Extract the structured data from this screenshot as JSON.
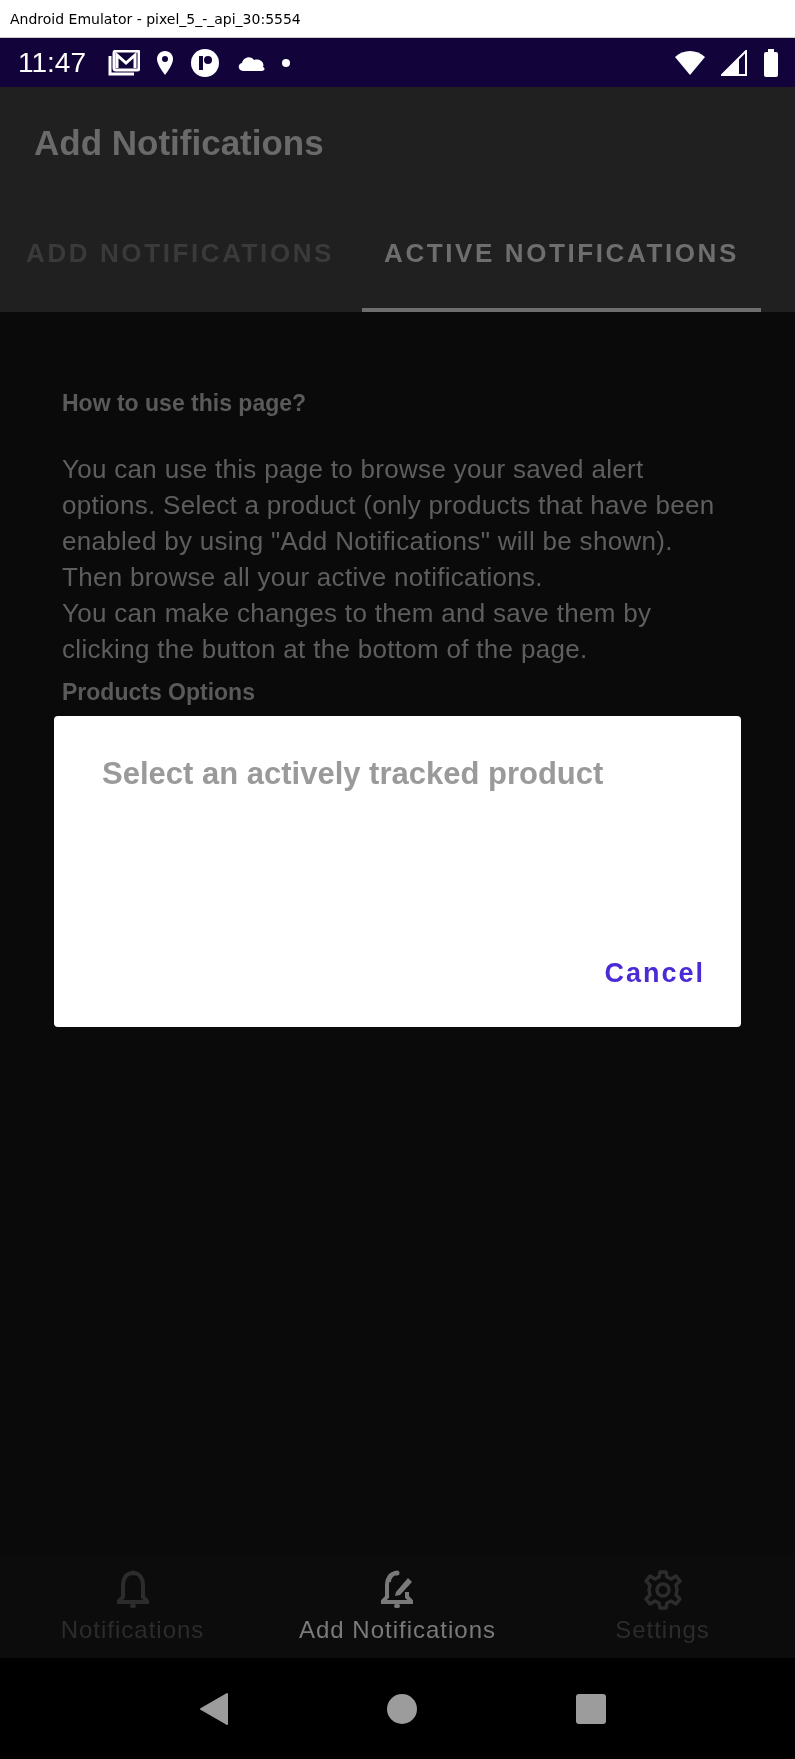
{
  "window": {
    "title": "Android Emulator - pixel_5_-_api_30:5554"
  },
  "status_bar": {
    "time": "11:47"
  },
  "app_bar": {
    "title": "Add Notifications"
  },
  "tabs": [
    {
      "label": "ADD NOTIFICATIONS",
      "selected": false
    },
    {
      "label": "ACTIVE NOTIFICATIONS",
      "selected": true
    }
  ],
  "content": {
    "heading": "How to use this page?",
    "paragraphs": [
      "You can use this page to browse your saved alert options. Select a product (only products that have been enabled by using \"Add Notifications\" will be shown). Then browse all your active notifications.",
      "You can make changes to them and save them by clicking the button at the bottom of the page."
    ],
    "section_heading": "Products Options"
  },
  "dialog": {
    "title": "Select an actively tracked product",
    "buttons": [
      "Cancel"
    ]
  },
  "bottom_nav": [
    {
      "label": "Notifications",
      "kind": "bell",
      "selected": false
    },
    {
      "label": "Add Notifications",
      "kind": "bell-edit",
      "selected": true
    },
    {
      "label": "Settings",
      "kind": "gear",
      "selected": false
    }
  ]
}
